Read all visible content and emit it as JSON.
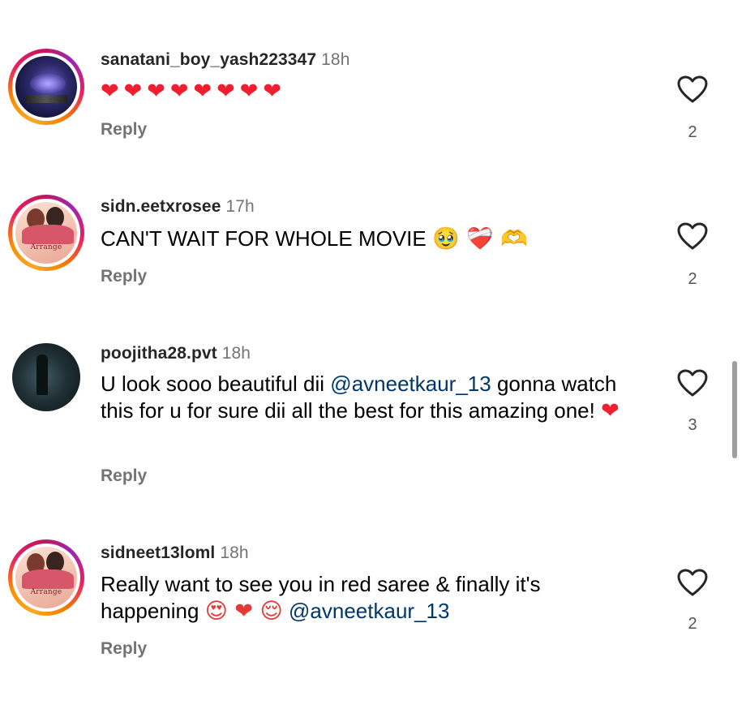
{
  "comments": [
    {
      "username": "sanatani_boy_yash223347",
      "time": "18h",
      "text": "",
      "emojis": "❤❤❤❤❤❤❤❤",
      "reply_label": "Reply",
      "likes": "2",
      "avatar": "space-wallpaper-avatar",
      "story_ring": true
    },
    {
      "username": "sidn.eetxrosee",
      "time": "17h",
      "text": "CAN'T WAIT FOR WHOLE MOVIE",
      "emojis": "🥹 ❤️‍🩹 🫶",
      "reply_label": "Reply",
      "likes": "2",
      "avatar": "movie-poster-avatar",
      "avatar_text": "Arrange",
      "story_ring": true
    },
    {
      "username": "poojitha28.pvt",
      "time": "18h",
      "text_before": "U look sooo beautiful dii",
      "mention": "@avneetkaur_13",
      "text_after": "gonna watch this for u for sure dii all the best for this amazing one!",
      "emojis": "❤",
      "reply_label": "Reply",
      "likes": "3",
      "avatar": "dark-figure-avatar",
      "story_ring": false
    },
    {
      "username": "sidneet13loml",
      "time": "18h",
      "text": "Really want to see you in red saree & finally it's happening",
      "emojis": "😍 ❤ 😌",
      "mention": "@avneetkaur_13",
      "reply_label": "Reply",
      "likes": "2",
      "avatar": "movie-poster-avatar",
      "avatar_text": "Arrange",
      "story_ring": true
    }
  ],
  "colors": {
    "mention": "#00376b",
    "heart": "#f01f2f",
    "secondary_text": "#737373"
  }
}
